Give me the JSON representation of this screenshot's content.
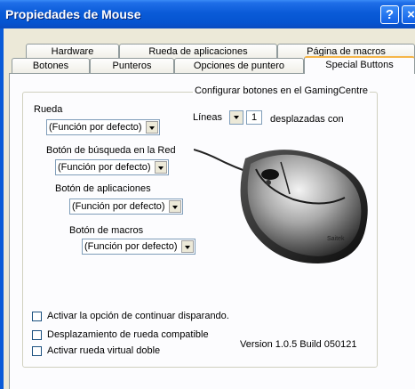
{
  "window": {
    "title": "Propiedades de Mouse",
    "help_label": "?",
    "close_label": "×"
  },
  "tabs": {
    "row1": [
      "Hardware",
      "Rueda de aplicaciones",
      "Página de macros"
    ],
    "row2": [
      "Botones",
      "Punteros",
      "Opciones de puntero",
      "Special Buttons"
    ],
    "active": "Special Buttons"
  },
  "group": {
    "title": "Configurar botones en el GamingCentre"
  },
  "wheel": {
    "label": "Rueda",
    "value": "(Función por defecto)"
  },
  "search": {
    "label": "Botón de búsqueda en la Red",
    "value": "(Función por defecto)"
  },
  "apps": {
    "label": "Botón de aplicaciones",
    "value": "(Función por defecto)"
  },
  "macros": {
    "label": "Botón de macros",
    "value": "(Función por defecto)"
  },
  "lines": {
    "label": "Líneas",
    "value": "1",
    "suffix": "desplazadas con"
  },
  "checkboxes": [
    {
      "label": "Activar la opción de continuar disparando.",
      "checked": false
    },
    {
      "label": "Desplazamiento de rueda compatible",
      "checked": false
    },
    {
      "label": "Activar rueda virtual doble",
      "checked": false
    }
  ],
  "version": "Version 1.0.5 Build 050121",
  "mouse_brand": "Saitek"
}
